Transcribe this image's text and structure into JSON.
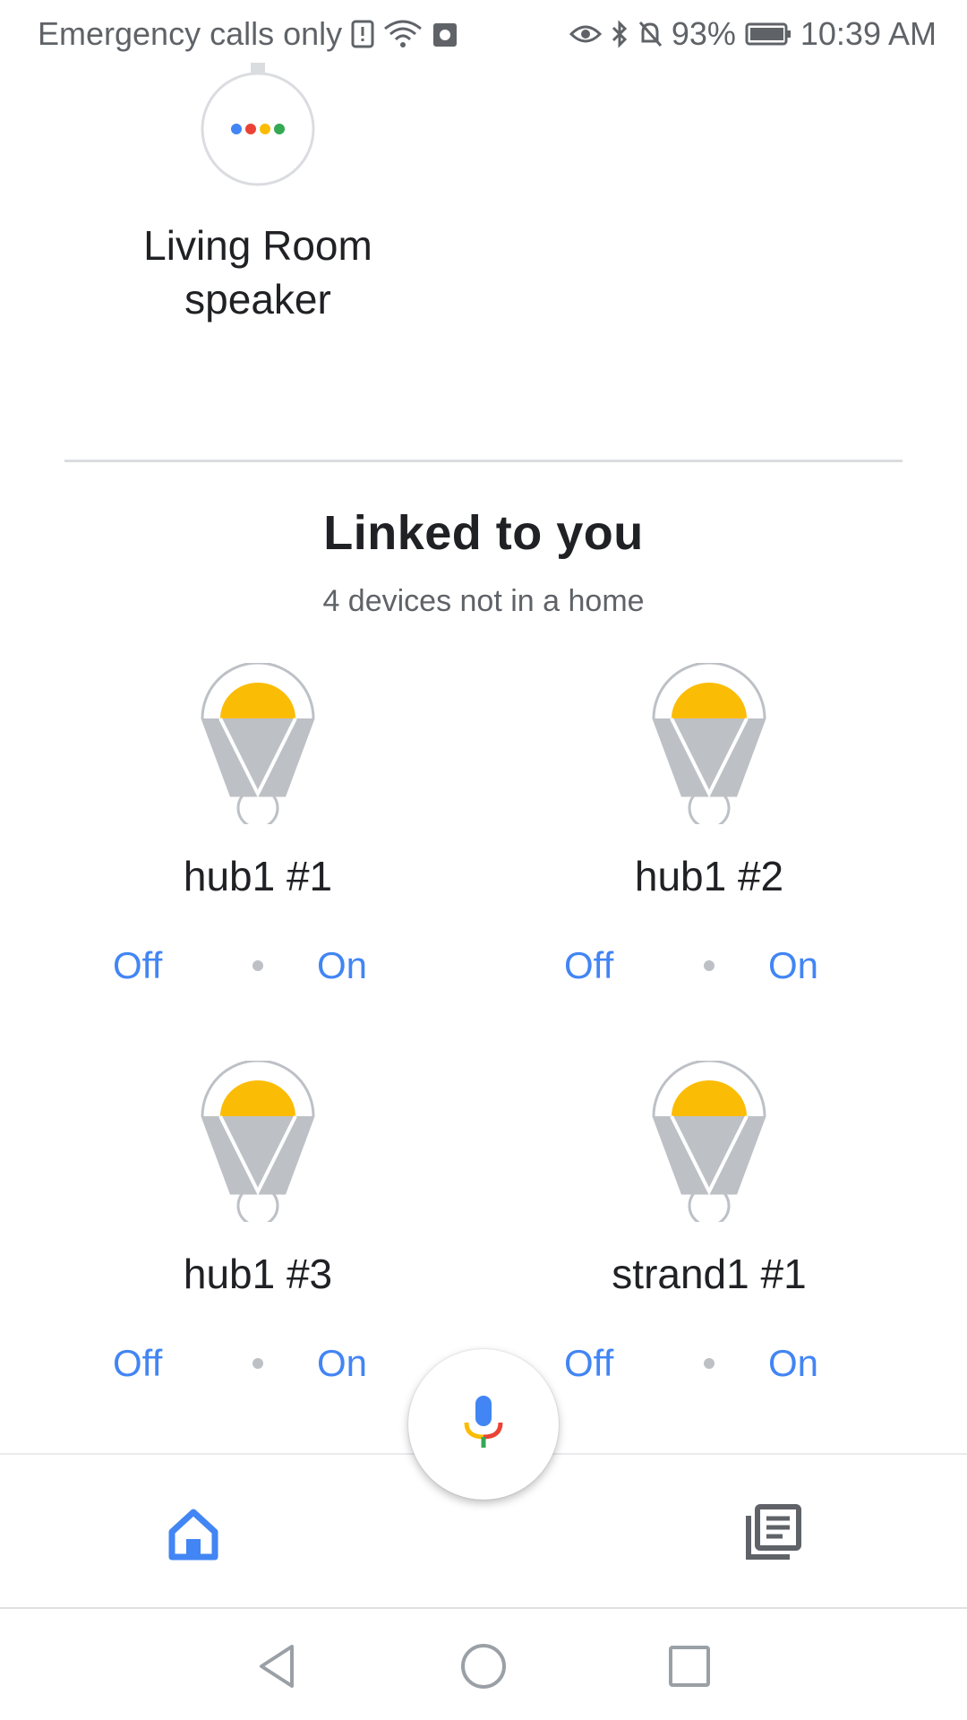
{
  "status_bar": {
    "carrier_text": "Emergency calls only",
    "battery": "93%",
    "time": "10:39 AM"
  },
  "speaker": {
    "label": "Living Room speaker",
    "dot_colors": [
      "#4285f4",
      "#ea4335",
      "#fbbc05",
      "#34a853"
    ]
  },
  "linked_section": {
    "title": "Linked to you",
    "subtitle": "4 devices not in a home"
  },
  "devices": [
    {
      "name": "hub1 #1",
      "off_label": "Off",
      "on_label": "On"
    },
    {
      "name": "hub1 #2",
      "off_label": "Off",
      "on_label": "On"
    },
    {
      "name": "hub1 #3",
      "off_label": "Off",
      "on_label": "On"
    },
    {
      "name": "strand1 #1",
      "off_label": "Off",
      "on_label": "On"
    }
  ],
  "bottom_nav": {
    "home_icon": "home-icon",
    "feed_icon": "feed-icon",
    "mic_icon": "mic-icon"
  },
  "colors": {
    "accent": "#4285f4",
    "bulb_yellow": "#fbbc05",
    "bulb_gray": "#bdc1c6",
    "icon_gray": "#5f6368"
  }
}
